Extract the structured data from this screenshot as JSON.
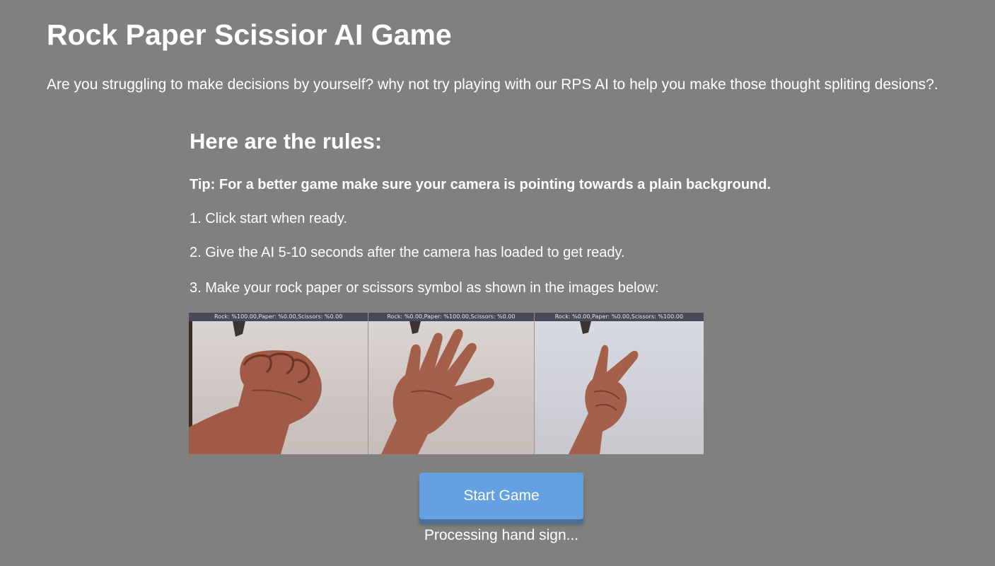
{
  "page": {
    "title": "Rock Paper Scissior AI Game",
    "intro": "Are you struggling to make decisions by yourself? why not try playing with our RPS AI to help you make those thought spliting desions?."
  },
  "rules": {
    "heading": "Here are the rules:",
    "tip": "Tip: For a better game make sure your camera is pointing towards a plain background.",
    "steps": [
      "1. Click start when ready.",
      "2. Give the AI 5-10 seconds after the camera has loaded to get ready.",
      "3. Make your rock paper or scissors symbol as shown in the images below:"
    ]
  },
  "examples": [
    {
      "gesture": "rock",
      "label": "Rock: %100.00,Paper: %0.00,Scissors: %0.00"
    },
    {
      "gesture": "paper",
      "label": "Rock: %0.00,Paper: %100.00,Scissors: %0.00"
    },
    {
      "gesture": "scissors",
      "label": "Rock: %0.00,Paper: %0.00,Scissors: %100.00"
    }
  ],
  "controls": {
    "start_label": "Start Game",
    "status": "Processing hand sign..."
  },
  "colors": {
    "background": "#808080",
    "button": "#65a1e0",
    "button_shadow": "#4c6f95",
    "text": "#ffffff"
  }
}
